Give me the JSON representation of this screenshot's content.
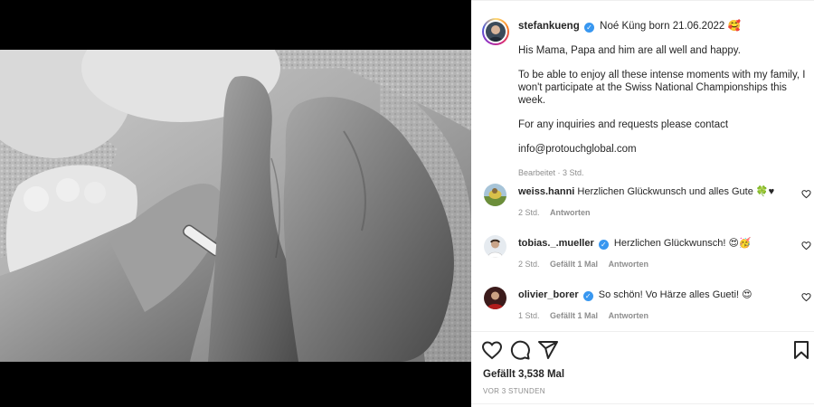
{
  "post": {
    "username": "stefankueng",
    "headline": "Noé Küng born 21.06.2022 🥰",
    "paragraphs": [
      "His Mama, Papa and him are all well and happy.",
      "To be able to enjoy all these intense moments with my family, I won't participate at the Swiss National Championships this week.",
      "For any inquiries and requests please contact",
      "info@protouchglobal.com"
    ],
    "edited": "Bearbeitet · 3 Std."
  },
  "comments": [
    {
      "username": "weiss.hanni",
      "verified": false,
      "text": "Herzlichen Glückwunsch und alles Gute 🍀♥",
      "time": "2 Std.",
      "likes": "",
      "reply": "Antworten"
    },
    {
      "username": "tobias._.mueller",
      "verified": true,
      "text": "Herzlichen Glückwunsch! 😍🥳",
      "time": "2 Std.",
      "likes": "Gefällt 1 Mal",
      "reply": "Antworten"
    },
    {
      "username": "olivier_borer",
      "verified": true,
      "text": "So schön! Vo Härze alles Gueti! 😍",
      "time": "1 Std.",
      "likes": "Gefällt 1 Mal",
      "reply": "Antworten"
    }
  ],
  "footer": {
    "likes": "Gefällt 3,538 Mal",
    "posted": "VOR 3 STUNDEN"
  },
  "icons": {
    "like": "heart-icon",
    "comment": "comment-icon",
    "share": "paper-plane-icon",
    "save": "bookmark-icon",
    "verified": "verified-badge-icon"
  },
  "colors": {
    "verified": "#3897f0",
    "muted": "#8e8e8e",
    "text": "#262626"
  }
}
